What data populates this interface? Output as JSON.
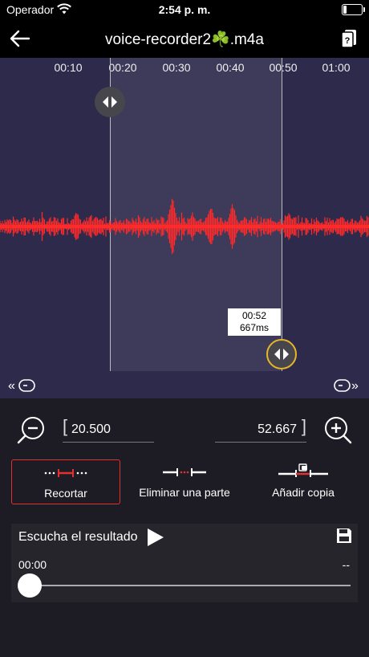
{
  "status_bar": {
    "carrier": "Operador",
    "time": "2:54 p. m."
  },
  "header": {
    "title": "voice-recorder2☘️.m4a"
  },
  "timeline": {
    "ticks": [
      "00:10",
      "00:20",
      "00:30",
      "00:40",
      "00:50",
      "01:00"
    ]
  },
  "selection_tooltip": {
    "time": "00:52",
    "ms": "667ms"
  },
  "range": {
    "start": "20.500",
    "end": "52.667"
  },
  "modes": [
    {
      "label": "Recortar",
      "active": true
    },
    {
      "label": "Eliminar una parte",
      "active": false
    },
    {
      "label": "Añadir copia",
      "active": false
    }
  ],
  "result": {
    "label": "Escucha el resultado",
    "current_time": "00:00",
    "duration": "--",
    "progress": 0
  },
  "colors": {
    "accent": "#e2312f",
    "waveform": "#ff2a2a",
    "handle_selected": "#e6b628",
    "waveform_bg": "#2d2a4c",
    "background": "#1d1c24"
  }
}
